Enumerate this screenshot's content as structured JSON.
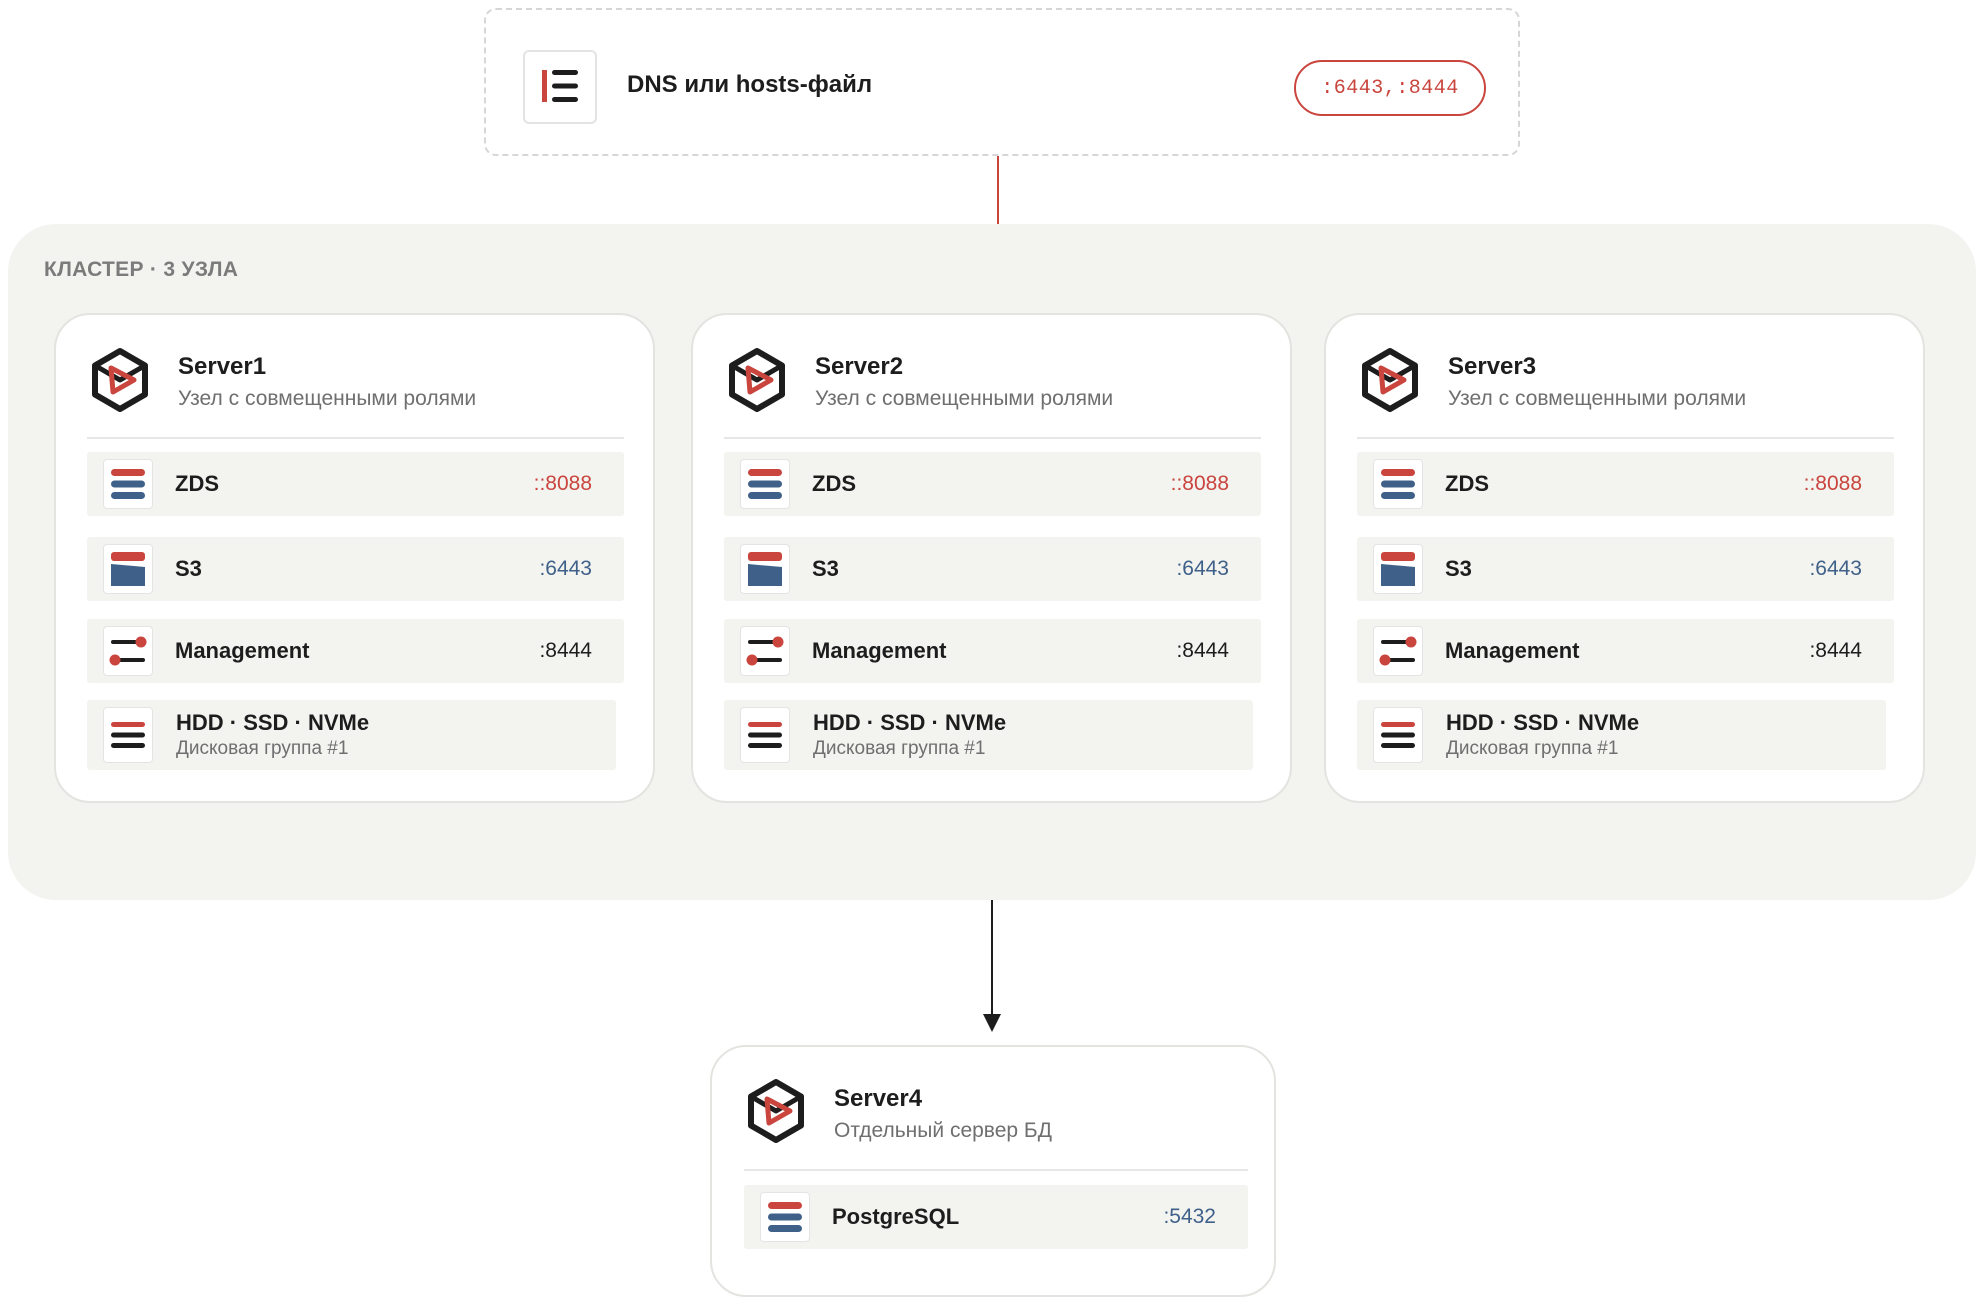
{
  "dns": {
    "title": "DNS или hosts-файл",
    "ports": ":6443,:8444",
    "icon": "dns-list-icon"
  },
  "cluster": {
    "label": "КЛАСТЕР · 3 УЗЛА",
    "servers": [
      {
        "name": "Server1",
        "subtitle": "Узел с совмещенными ролями",
        "services": [
          {
            "label": "ZDS",
            "port": "::8088",
            "icon": "zds-stack-icon"
          },
          {
            "label": "S3",
            "port": ":6443",
            "icon": "s3-bucket-icon"
          },
          {
            "label": "Management",
            "port": ":8444",
            "icon": "management-sliders-icon"
          }
        ],
        "disk": {
          "label": "HDD · SSD · NVMe",
          "sub": "Дисковая группа #1",
          "icon": "disk-group-icon"
        }
      },
      {
        "name": "Server2",
        "subtitle": "Узел с совмещенными ролями",
        "services": [
          {
            "label": "ZDS",
            "port": "::8088",
            "icon": "zds-stack-icon"
          },
          {
            "label": "S3",
            "port": ":6443",
            "icon": "s3-bucket-icon"
          },
          {
            "label": "Management",
            "port": ":8444",
            "icon": "management-sliders-icon"
          }
        ],
        "disk": {
          "label": "HDD · SSD · NVMe",
          "sub": "Дисковая группа #1",
          "icon": "disk-group-icon"
        }
      },
      {
        "name": "Server3",
        "subtitle": "Узел с совмещенными ролями",
        "services": [
          {
            "label": "ZDS",
            "port": "::8088",
            "icon": "zds-stack-icon"
          },
          {
            "label": "S3",
            "port": ":6443",
            "icon": "s3-bucket-icon"
          },
          {
            "label": "Management",
            "port": ":8444",
            "icon": "management-sliders-icon"
          }
        ],
        "disk": {
          "label": "HDD · SSD · NVMe",
          "sub": "Дисковая группа #1",
          "icon": "disk-group-icon"
        }
      }
    ]
  },
  "db_server": {
    "name": "Server4",
    "subtitle": "Отдельный сервер БД",
    "service": {
      "label": "PostgreSQL",
      "port": ":5432",
      "icon": "postgres-stack-icon"
    }
  },
  "colors": {
    "accent_red": "#c9453e",
    "accent_blue": "#3f6189",
    "panel_bg": "#f3f3f0",
    "text_dark": "#1d1d1d",
    "text_muted": "#6f6f6f"
  }
}
